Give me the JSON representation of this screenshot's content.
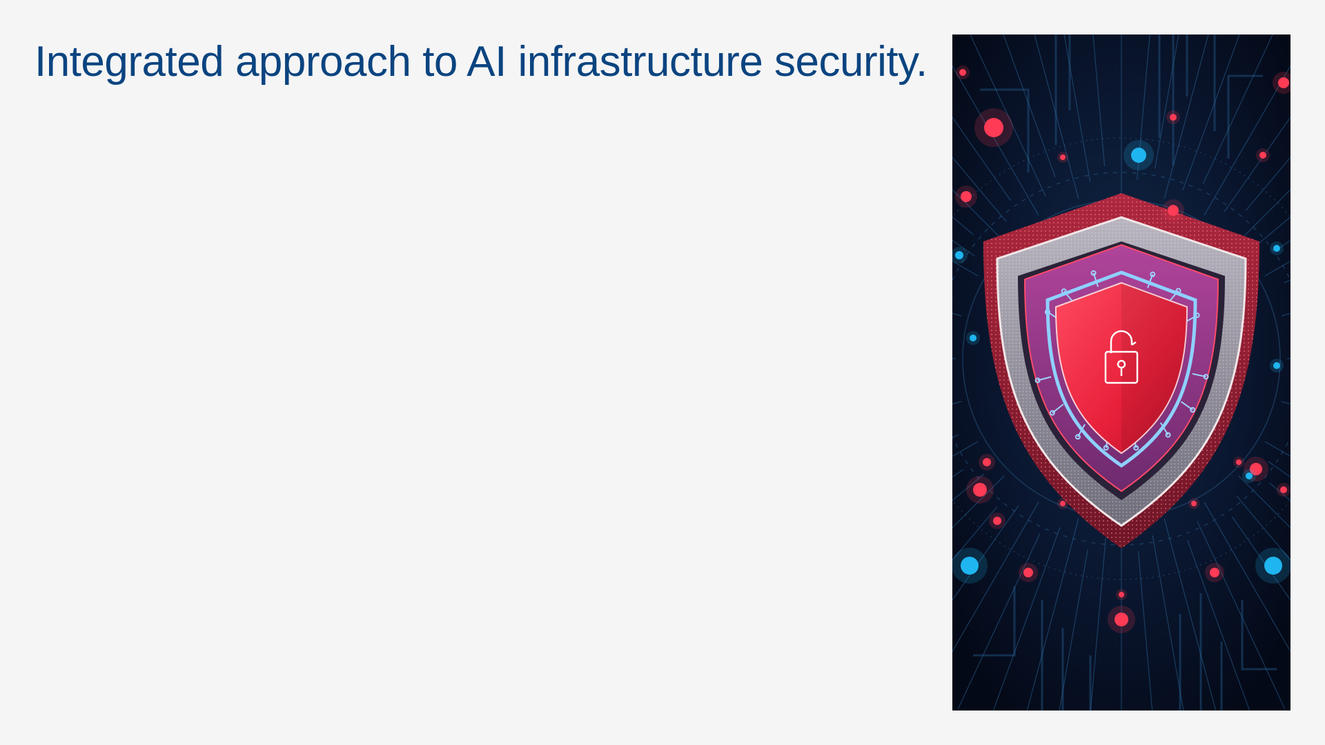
{
  "slide": {
    "title": "Integrated approach to AI infrastructure security.",
    "title_color": "#0b4480",
    "background_color": "#f5f5f5"
  },
  "image": {
    "subject": "shield-lock-icon",
    "palette": {
      "background": "#050b1c",
      "circuit": "#1f4d78",
      "accent_red": "#ff3b55",
      "accent_blue": "#1fb5f0",
      "shield_core": "#f0293f",
      "shield_mid": "#9b3a8c",
      "shield_silver": "#9a9aa8"
    }
  }
}
